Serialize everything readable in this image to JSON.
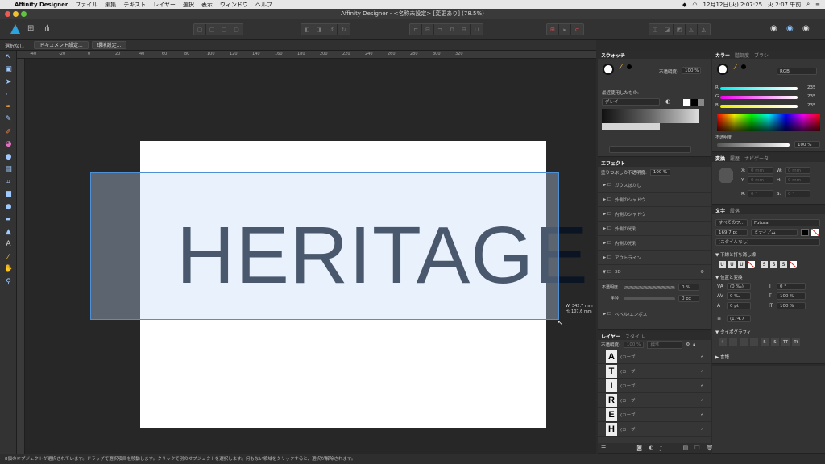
{
  "menubar": {
    "app": "Affinity Designer",
    "items": [
      "ファイル",
      "編集",
      "テキスト",
      "レイヤー",
      "選択",
      "表示",
      "ウィンドウ",
      "ヘルプ"
    ],
    "clock": "12月12日(火) 2:07:25",
    "clock2": "火 2:07 午前"
  },
  "window": {
    "title": "Affinity Designer - <名称未設定> [変更あり] (78.5%)"
  },
  "context": {
    "selection": "選択なし",
    "doc_setup": "ドキュメント設定...",
    "prefs": "環境設定..."
  },
  "ruler": {
    "ticks": [
      "-40",
      "-20",
      "0",
      "20",
      "40",
      "60",
      "80",
      "100",
      "120",
      "140",
      "160",
      "180",
      "200",
      "220",
      "240",
      "260",
      "280",
      "300",
      "320"
    ]
  },
  "canvas": {
    "artwork_text": "HERITAGE",
    "size_w": "W: 342.7 mm",
    "size_h": "H: 107.6 mm"
  },
  "status": {
    "text": "8個のオブジェクトが選択されています。ドラッグで選択項目を移動します。クリックで別のオブジェクトを選択します。何もない領域をクリックすると、選択が解除されます。"
  },
  "swatches": {
    "tab": "スウォッチ",
    "opacity_label": "不透明度:",
    "opacity": "100 %",
    "recent": "最近使用したもの:",
    "palette": "グレイ"
  },
  "effects": {
    "tab": "エフェクト",
    "fill_opacity": "塗りつぶしの不透明度:",
    "fill_opacity_value": "100 %",
    "items": [
      "ガウスぼかし",
      "外側のシャドウ",
      "内側のシャドウ",
      "外側の光彩",
      "内側の光彩",
      "アウトライン",
      "3D",
      "ベベル/エンボス"
    ],
    "opacity_label": "不透明度",
    "opacity_value": "0 %",
    "radius_label": "半径",
    "radius_value": "0 px"
  },
  "layers": {
    "tabs": [
      "レイヤー",
      "スタイル"
    ],
    "opacity_label": "不透明度:",
    "opacity": "100 %",
    "blend": "標準",
    "rows": [
      {
        "thumb": "A",
        "label": "(カーブ)",
        "check": "✓"
      },
      {
        "thumb": "T",
        "label": "(カーブ)",
        "check": "✓"
      },
      {
        "thumb": "I",
        "label": "(カーブ)",
        "check": "✓"
      },
      {
        "thumb": "R",
        "label": "(カーブ)",
        "check": "✓"
      },
      {
        "thumb": "E",
        "label": "(カーブ)",
        "check": "✓"
      },
      {
        "thumb": "H",
        "label": "(カーブ)",
        "check": "✓"
      }
    ]
  },
  "color": {
    "tabs": [
      "カラー",
      "階調度",
      "ブラシ"
    ],
    "mode": "RGB",
    "r_label": "R",
    "r": "235",
    "g_label": "G",
    "g": "235",
    "b_label": "B",
    "b": "235",
    "opacity_label": "不透明度",
    "opacity": "100 %"
  },
  "transform": {
    "tabs": [
      "変換",
      "履歴",
      "ナビゲータ"
    ],
    "x_label": "X:",
    "x": "0 mm",
    "y_label": "Y:",
    "y": "0 mm",
    "w_label": "W:",
    "w": "0 mm",
    "h_label": "H:",
    "h": "0 mm",
    "r_label": "R:",
    "r": "0 °",
    "s_label": "S:",
    "s": "0 °"
  },
  "text": {
    "tabs": [
      "文字",
      "段落"
    ],
    "font_collection": "すべてのフ...",
    "font": "Futura",
    "size": "169.7 pt",
    "weight": "ミディアム",
    "style": "[スタイルなし]",
    "underline_section": "下線と打ち消し線",
    "position_section": "位置と変換",
    "kerning": "(0 ‰)",
    "tracking": "0 ‰",
    "baseline": "0 pt",
    "leading": "(174.7",
    "italic": "0 °",
    "hscale": "100 %",
    "vscale": "100 %",
    "typography_section": "タイポグラフィ",
    "language_section": "言語"
  }
}
